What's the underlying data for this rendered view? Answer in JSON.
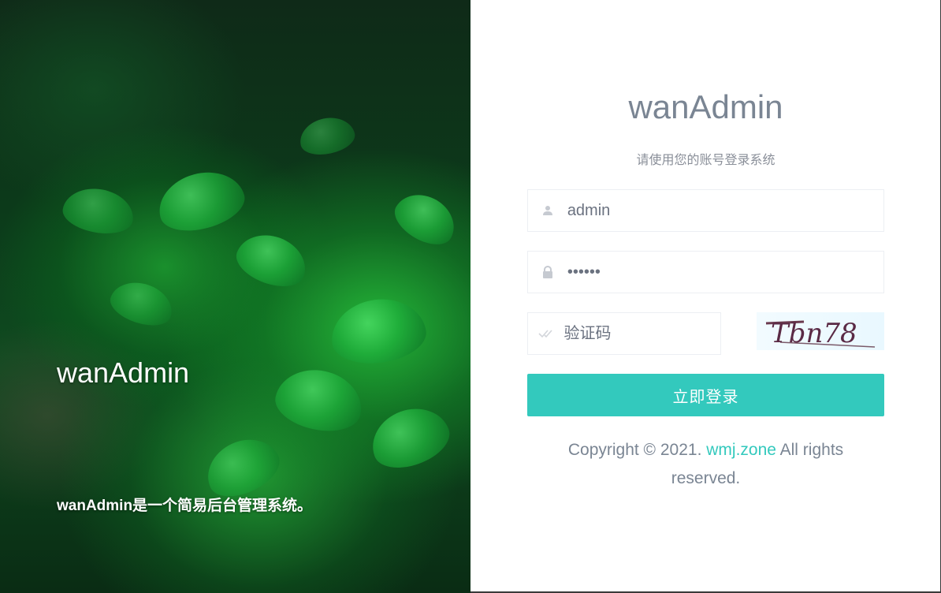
{
  "hero": {
    "title": "wanAdmin",
    "description": "wanAdmin是一个简易后台管理系统。"
  },
  "login": {
    "title": "wanAdmin",
    "subtitle": "请使用您的账号登录系统",
    "username": {
      "value": "admin",
      "icon": "user-icon"
    },
    "password": {
      "value": "••••••",
      "icon": "lock-icon"
    },
    "captcha": {
      "placeholder": "验证码",
      "icon": "double-check-icon",
      "image_text": "Tbn78"
    },
    "submit_label": "立即登录",
    "copyright": {
      "prefix": "Copyright © 2021. ",
      "link_text": "wmj.zone",
      "suffix": " All rights reserved."
    }
  },
  "colors": {
    "accent": "#33c9bd",
    "title_gray": "#7a8593",
    "hero_green": "#1fb03c"
  }
}
